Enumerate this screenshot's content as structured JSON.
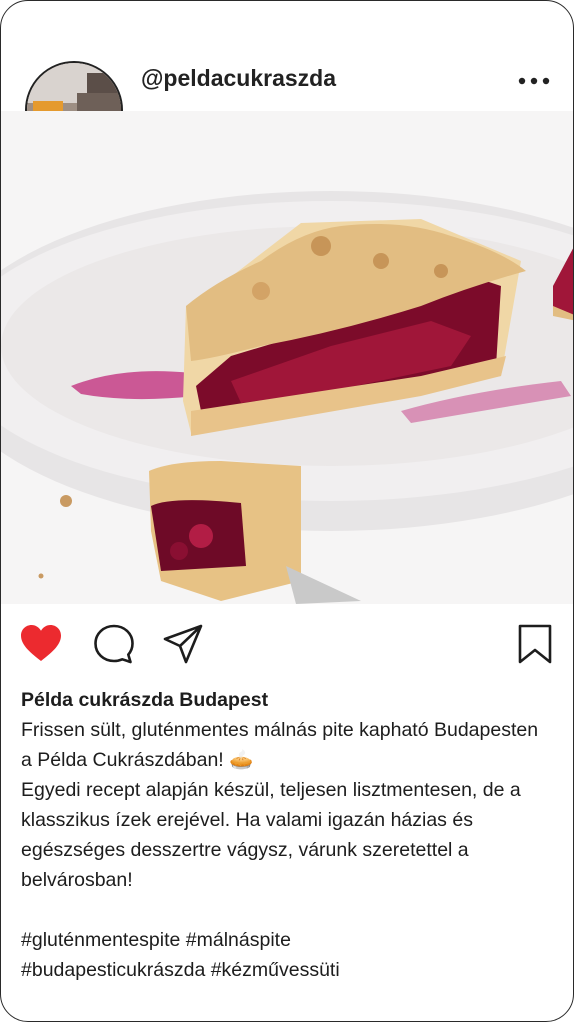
{
  "post": {
    "username": "@peldacukraszda",
    "caption_title": "Példa cukrászda Budapest",
    "caption_text": "Frissen sült, gluténmentes málnás pite kapható Budapesten a Példa Cukrászdában! 🥧\nEgyedi recept alapján készül, teljesen lisztmentesen, de a klasszikus ízek erejével. Ha valami igazán házias és egészséges desszertre vágysz, várunk szeretettel a belvárosban!",
    "hashtags": "#gluténmentespite #málnáspite\n#budapesticukrászda #kézművessüti"
  },
  "icons": {
    "more": "more-options-icon",
    "like": "heart-icon",
    "comment": "comment-icon",
    "share": "share-icon",
    "save": "bookmark-icon"
  },
  "colors": {
    "like": "#ec2a2f",
    "text": "#1d1d1d"
  }
}
